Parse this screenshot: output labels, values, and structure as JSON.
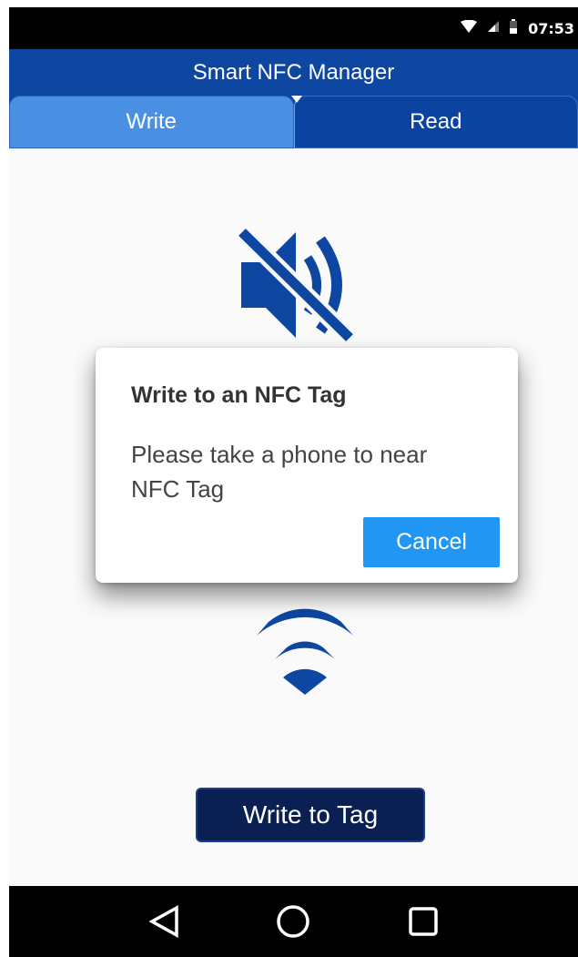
{
  "status_bar": {
    "time": "07:53",
    "icons": [
      "wifi-icon",
      "signal-icon",
      "battery-icon"
    ]
  },
  "app_bar": {
    "title": "Smart NFC Manager"
  },
  "tabs": [
    {
      "label": "Write",
      "selected": true
    },
    {
      "label": "Read",
      "selected": false
    }
  ],
  "main": {
    "icons": [
      "volume-off-icon",
      "nfc-signal-icon"
    ],
    "write_button_label": "Write to Tag"
  },
  "dialog": {
    "title": "Write to an NFC Tag",
    "message": "Please take a phone to near NFC Tag",
    "cancel_label": "Cancel"
  },
  "nav_bar": {
    "icons": [
      "back-icon",
      "home-icon",
      "recents-icon"
    ]
  },
  "colors": {
    "primary": "#0d47a1",
    "tab_selected": "#4a90e2",
    "accent": "#2196f3",
    "button_dark": "#0a1f52",
    "icon_blue": "#0d47a1"
  }
}
